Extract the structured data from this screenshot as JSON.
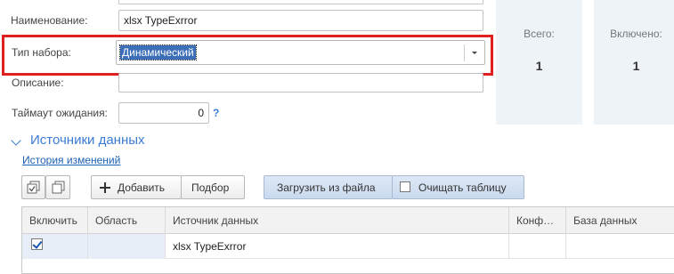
{
  "form": {
    "name_label": "Наименование:",
    "name_value": "xlsx TypeExrror",
    "set_type_label": "Тип набора:",
    "set_type_value": "Динамический",
    "description_label": "Описание:",
    "description_value": "",
    "timeout_label": "Таймаут ожидания:",
    "timeout_value": "0",
    "timeout_help": "?"
  },
  "stats": {
    "total_label": "Всего:",
    "total_value": "1",
    "enabled_label": "Включено:",
    "enabled_value": "1"
  },
  "section": {
    "title": "Источники данных",
    "history_link": "История изменений"
  },
  "toolbar": {
    "add_label": "Добавить",
    "select_label": "Подбор",
    "load_file_label": "Загрузить из файла",
    "clear_table_label": "Очищать таблицу",
    "clear_table_checked": false
  },
  "table": {
    "columns": [
      "Включить",
      "Область",
      "Источник данных",
      "Конф…",
      "База данных"
    ],
    "rows": [
      {
        "enabled": true,
        "area": "",
        "source": "xlsx TypeExrror",
        "config": "",
        "database": ""
      }
    ]
  },
  "colors": {
    "accent": "#3a7bd5",
    "highlight_border": "#e02020",
    "selection": "#3c6fb8",
    "stat_panel": "#eef3f8"
  }
}
